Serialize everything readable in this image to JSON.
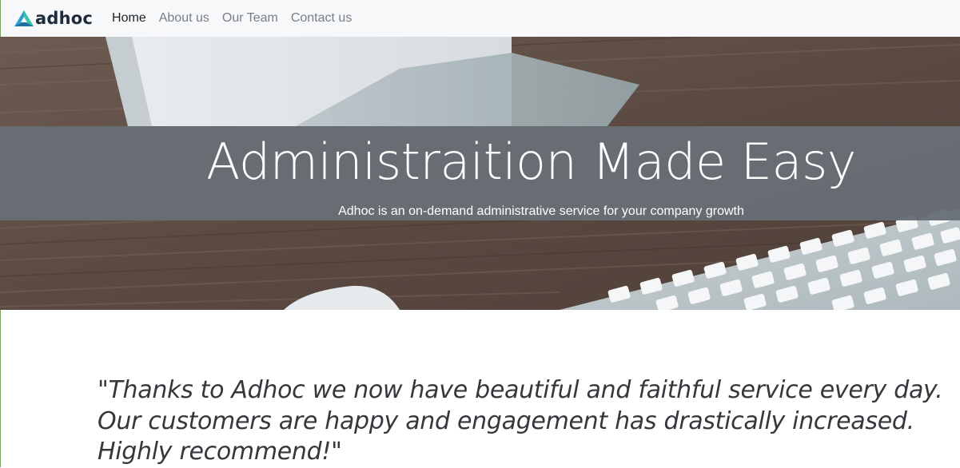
{
  "brand": {
    "name": "adhoc",
    "logo_icon": "triangle-logo-icon",
    "logo_colors": [
      "#2a9fd0",
      "#35c2a8",
      "#1d6f9e"
    ]
  },
  "nav": {
    "items": [
      {
        "label": "Home",
        "active": true
      },
      {
        "label": "About us",
        "active": false
      },
      {
        "label": "Our Team",
        "active": false
      },
      {
        "label": "Contact us",
        "active": false
      }
    ]
  },
  "hero": {
    "title": "Administraition Made Easy",
    "subtitle": "Adhoc is an on-demand administrative service for your company growth",
    "background_image": "desk-with-monitor-and-keyboard",
    "band_color": "#686e76"
  },
  "testimonial": {
    "quote": "\"Thanks to Adhoc we now have beautiful and faithful service every day. Our customers are happy and engagement has drastically increased. Highly recommend!\""
  }
}
